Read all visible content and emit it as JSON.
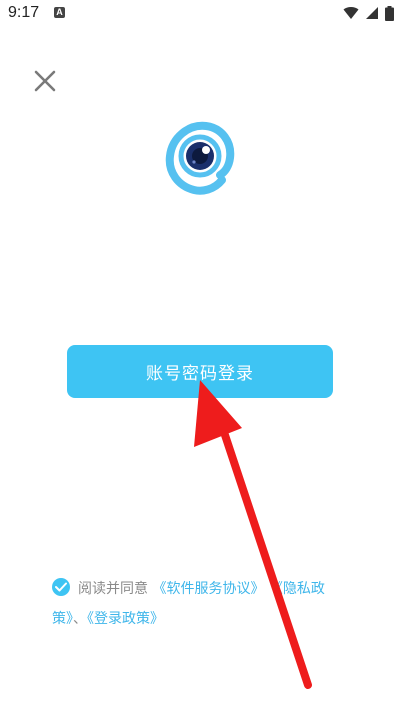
{
  "status_bar": {
    "time": "9:17",
    "notification_icon": "app-notification-icon",
    "icons": [
      "wifi-icon",
      "cellular-signal-icon",
      "battery-icon"
    ]
  },
  "header": {
    "close_icon": "close-icon"
  },
  "logo": {
    "icon": "camera-eye-at-logo",
    "colors": {
      "ring": "#56c1f0",
      "eye": "#1a2f6b"
    }
  },
  "login": {
    "button_label": "账号密码登录",
    "color": "#3ec4f3"
  },
  "agreement": {
    "checked": true,
    "prefix": "阅读并同意",
    "software_link": "《软件服务协议》",
    "privacy_link": "《隐私政策》",
    "separator": "、",
    "login_policy_link": "《登录政策》",
    "link_color": "#3fb6ea"
  },
  "annotation": {
    "type": "arrow",
    "color": "#ee1c1c",
    "points_to": "login-button"
  }
}
